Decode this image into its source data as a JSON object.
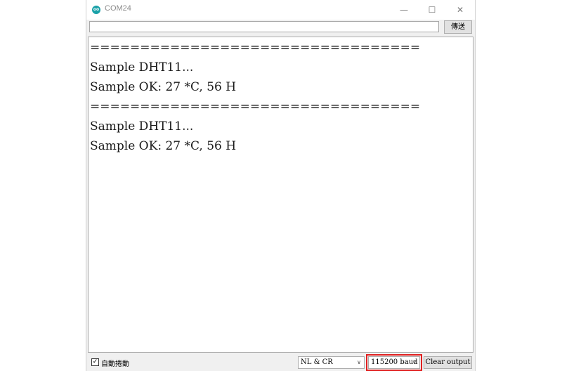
{
  "window": {
    "title": "COM24",
    "icon": "arduino-logo-icon",
    "icon_text": "oo",
    "minimize_glyph": "—",
    "maximize_glyph": "☐",
    "close_glyph": "✕"
  },
  "send": {
    "input_value": "",
    "button_label": "傳送"
  },
  "output": {
    "lines": [
      "=================================",
      "Sample DHT11...",
      "Sample OK: 27 *C, 56 H",
      "=================================",
      "Sample DHT11...",
      "Sample OK: 27 *C, 56 H"
    ]
  },
  "bottom": {
    "autoscroll_checked": true,
    "autoscroll_check_glyph": "✓",
    "autoscroll_label": "自動捲動",
    "line_ending": "NL & CR",
    "baud_rate": "115200 baud",
    "clear_label": "Clear output",
    "chevron_glyph": "∨"
  },
  "colors": {
    "highlight": "#e02020",
    "icon": "#1aa1a8"
  }
}
